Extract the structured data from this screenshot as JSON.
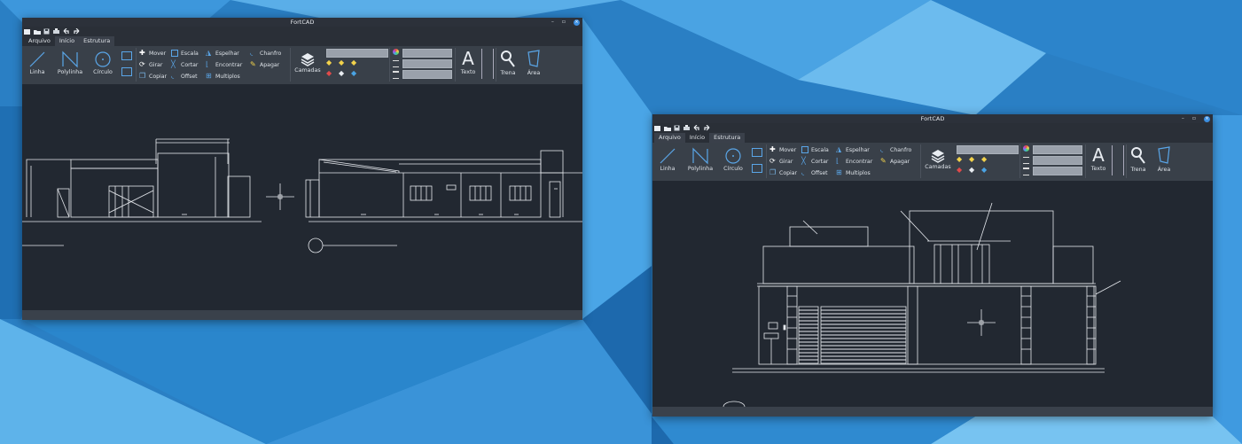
{
  "desktop": {
    "wallpaper_colors": [
      "#1e6fb5",
      "#3b9be0",
      "#7cc4f2"
    ]
  },
  "windows": [
    {
      "title": "FortCAD",
      "controls": {
        "minimize": "–",
        "maximize": "▫",
        "close": "×"
      },
      "quick_access": [
        "new-file-icon",
        "open-folder-icon",
        "save-icon",
        "print-icon",
        "undo-icon",
        "redo-icon"
      ],
      "tabs": [
        {
          "label": "Arquivo"
        },
        {
          "label": "Início"
        },
        {
          "label": "Estrutura"
        }
      ],
      "active_tab": "Início",
      "ribbon": {
        "draw": {
          "line": "Linha",
          "polyline": "Polylinha",
          "circle": "Círculo"
        },
        "modify": {
          "move": "Mover",
          "rotate": "Girar",
          "copy": "Copiar",
          "scale": "Escala",
          "trim": "Cortar",
          "offset": "Offset",
          "mirror": "Espelhar",
          "extend": "Encontrar",
          "array": "Multiplos",
          "chamfer": "Chanfro",
          "erase": "Apagar"
        },
        "layers": "Camadas",
        "text": "Texto",
        "measure": "Trena",
        "area": "Área"
      }
    },
    {
      "title": "FortCAD",
      "controls": {
        "minimize": "–",
        "maximize": "▫",
        "close": "×"
      },
      "quick_access": [
        "new-file-icon",
        "open-folder-icon",
        "save-icon",
        "print-icon",
        "undo-icon",
        "redo-icon"
      ],
      "tabs": [
        {
          "label": "Arquivo"
        },
        {
          "label": "Início"
        },
        {
          "label": "Estrutura"
        }
      ],
      "active_tab": "Estrutura",
      "ribbon": {
        "draw": {
          "line": "Linha",
          "polyline": "Polylinha",
          "circle": "Círculo"
        },
        "modify": {
          "move": "Mover",
          "rotate": "Girar",
          "copy": "Copiar",
          "scale": "Escala",
          "trim": "Cortar",
          "offset": "Offset",
          "mirror": "Espelhar",
          "extend": "Encontrar",
          "array": "Multiplos",
          "chamfer": "Chanfro",
          "erase": "Apagar"
        },
        "layers": "Camadas",
        "text": "Texto",
        "measure": "Trena",
        "area": "Área"
      }
    }
  ]
}
